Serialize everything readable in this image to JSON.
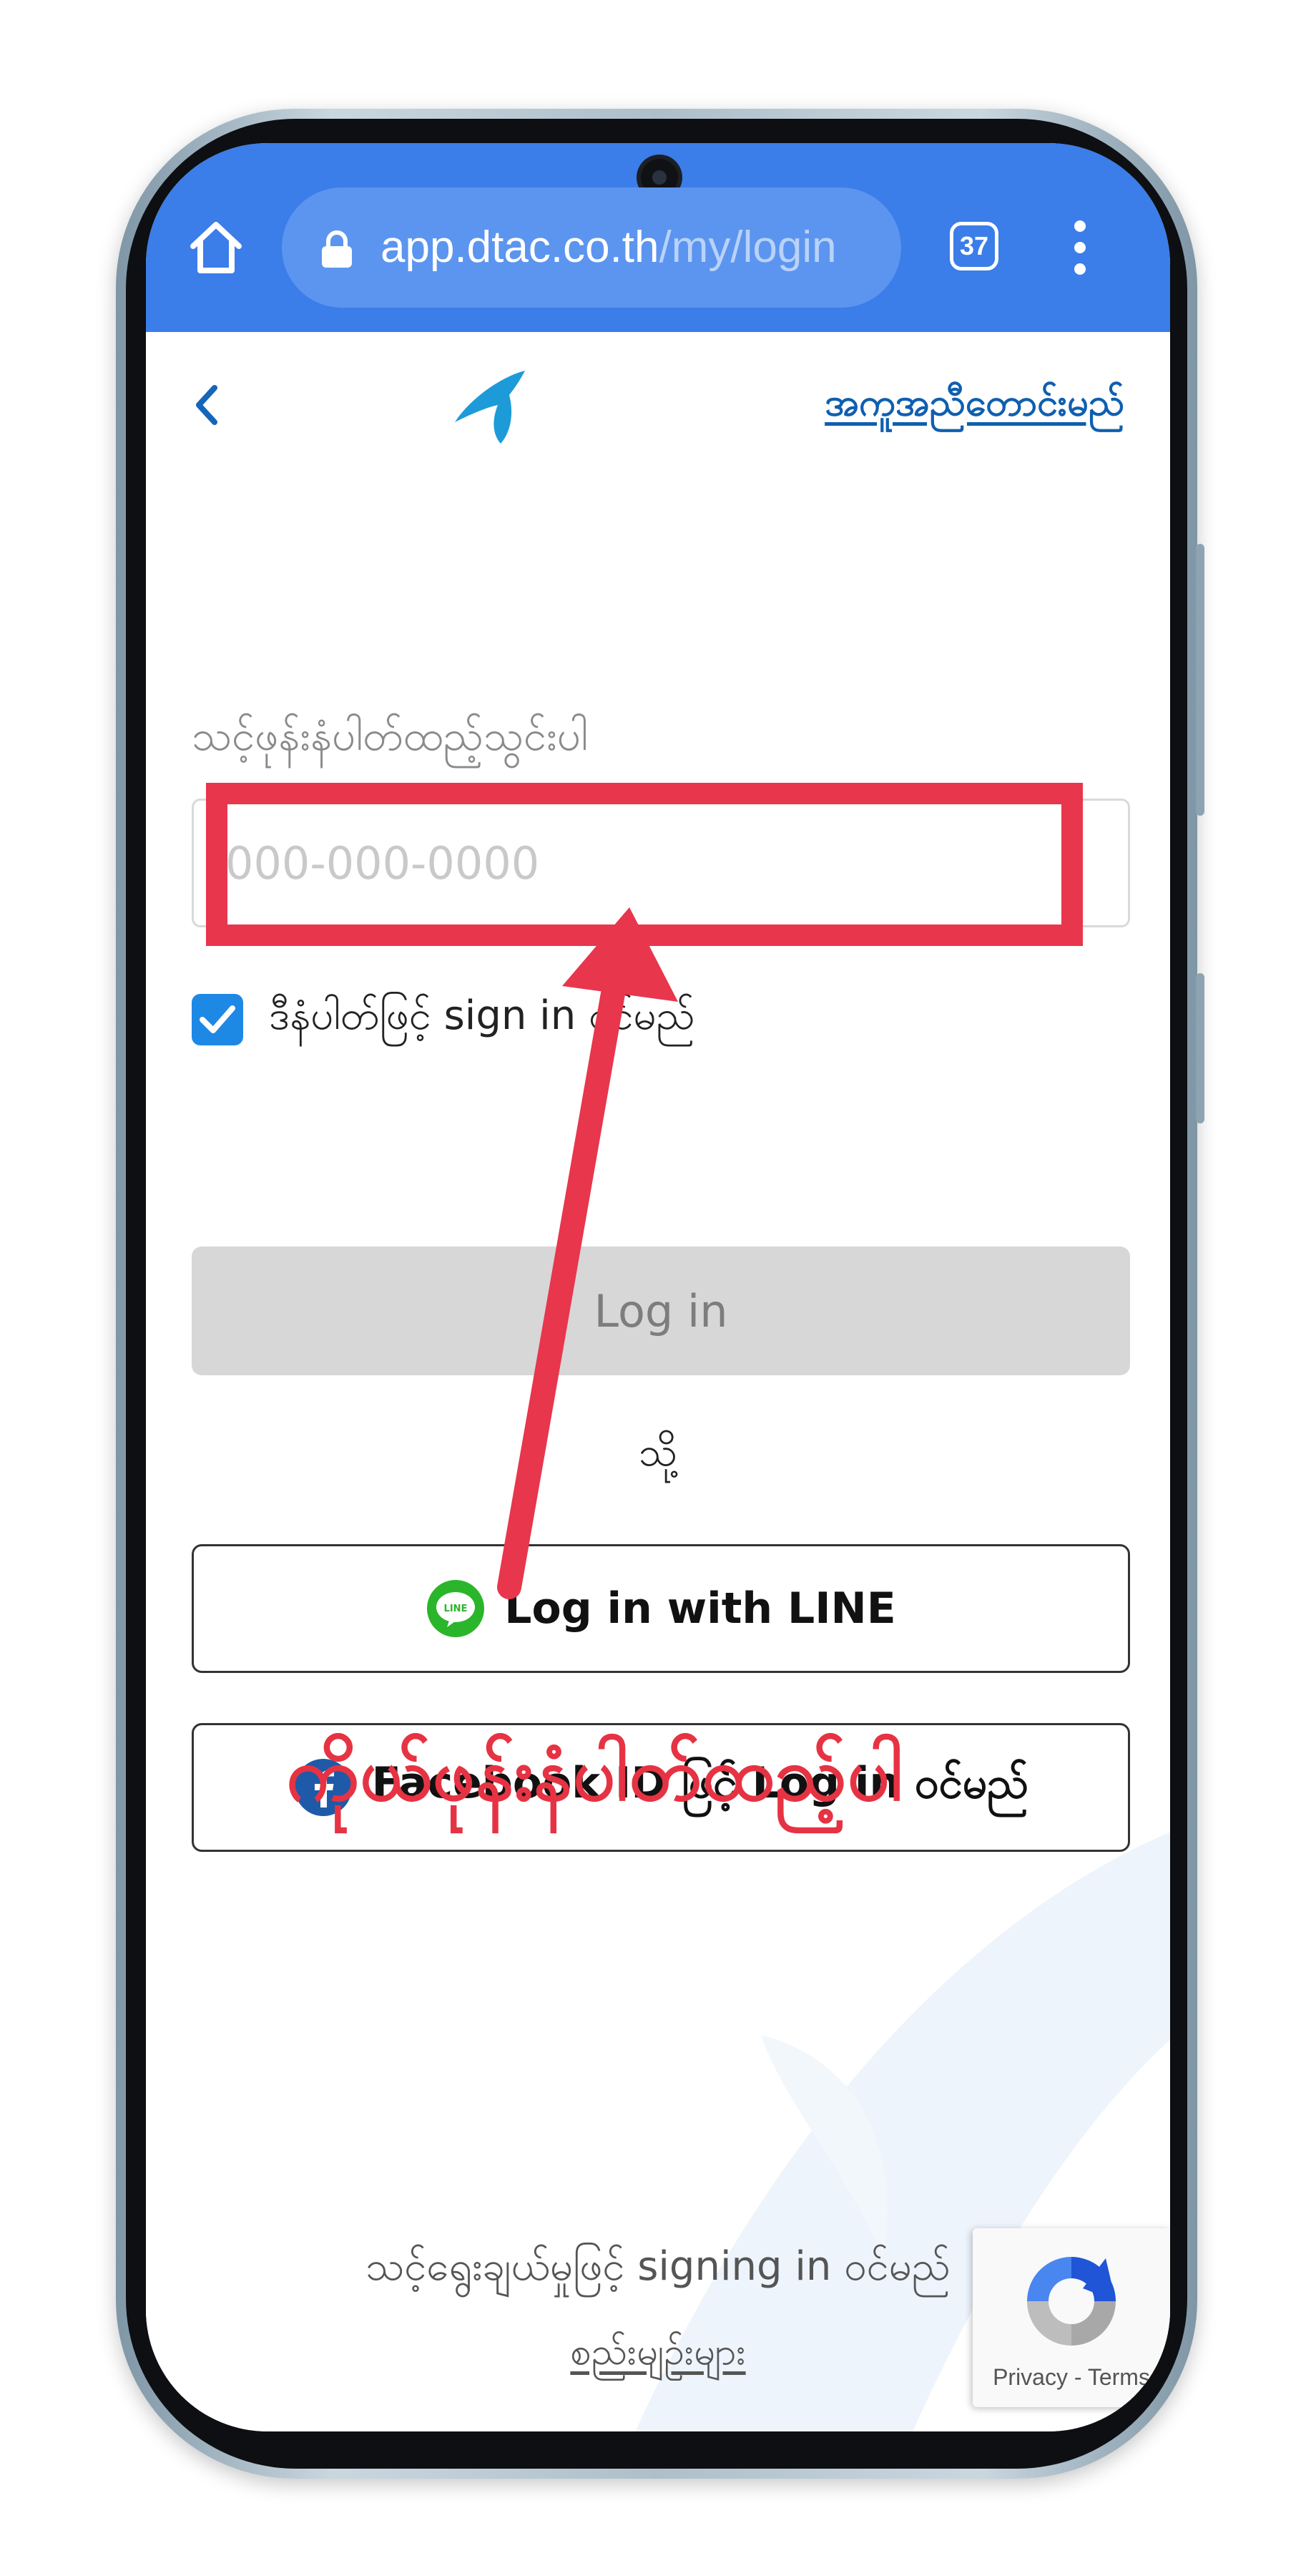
{
  "browser": {
    "url_host": "app.dtac.co.th",
    "url_path": "/my/login",
    "tab_count": "37"
  },
  "header": {
    "help_link": "အကူအညီတောင်းမည်"
  },
  "login_form": {
    "phone_label": "သင့်ဖုန်းနံပါတ်ထည့်သွင်းပါ",
    "phone_placeholder": "000-000-0000",
    "phone_value": "",
    "remember_label": "ဒီနံပါတ်ဖြင့် sign in ဝင်မည်",
    "remember_checked": true,
    "login_button": "Log in",
    "or_text": "သို့",
    "line_button": "Log in with LINE",
    "facebook_button": "Facebook ID ဖြင့် Log in ဝင်မည်",
    "line_icon_text": "LINE"
  },
  "footer": {
    "consent_text": "သင့်ရွေးချယ်မှုဖြင့် signing in ဝင်မည်",
    "terms_link": "စည်းမျဉ်းများ"
  },
  "recaptcha": {
    "links": "Privacy - Terms"
  },
  "annotation": {
    "text": "ကိုယ်ဖုန်းနံပါတ်ထည့်ပါ"
  },
  "colors": {
    "browser_bar": "#3b7de9",
    "brand_blue": "#1d9bd9",
    "link_blue": "#0f5fb0",
    "checkbox_blue": "#1e88e5",
    "annotation_red": "#e8364d",
    "line_green": "#2bb52b",
    "facebook_blue": "#1f5aa8"
  }
}
